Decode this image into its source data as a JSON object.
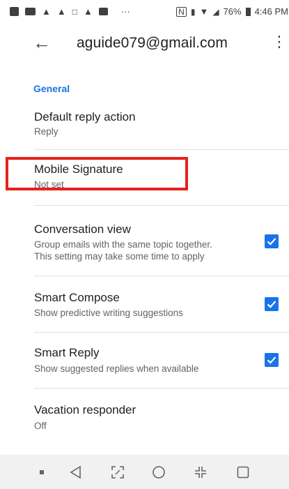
{
  "status_bar": {
    "battery": "76%",
    "time": "4:46 PM",
    "more": "···"
  },
  "app_bar": {
    "back_label": "←",
    "account": "aguide079@gmail.com",
    "more_label": "⋮"
  },
  "section": {
    "title": "General"
  },
  "settings": [
    {
      "title": "Default reply action",
      "subtitle": "Reply"
    },
    {
      "title": "Mobile Signature",
      "subtitle": "Not set"
    },
    {
      "title": "Conversation view",
      "subtitle_line1": "Group emails with the same topic together.",
      "subtitle_line2": "This setting may take some time to apply",
      "checked": true
    },
    {
      "title": "Smart Compose",
      "subtitle": "Show predictive writing suggestions",
      "checked": true
    },
    {
      "title": "Smart Reply",
      "subtitle": "Show suggested replies when available",
      "checked": true
    },
    {
      "title": "Vacation responder",
      "subtitle": "Off"
    }
  ],
  "colors": {
    "accent": "#1a73e8",
    "highlight": "#e8201b"
  },
  "nav_icons": [
    "square-dot-icon",
    "back-triangle-icon",
    "screenshot-icon",
    "home-circle-icon",
    "collapse-icon",
    "recents-square-icon"
  ]
}
